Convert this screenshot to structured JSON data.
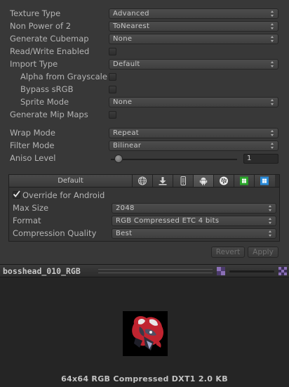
{
  "texture_settings": [
    {
      "label": "Texture Type",
      "value": "Advanced"
    },
    {
      "label": "Non Power of 2",
      "value": "ToNearest"
    },
    {
      "label": "Generate Cubemap",
      "value": "None"
    },
    {
      "label": "Read/Write Enabled"
    },
    {
      "label": "Import Type",
      "value": "Default"
    },
    {
      "label": "Alpha from Grayscale"
    },
    {
      "label": "Bypass sRGB"
    },
    {
      "label": "Sprite Mode",
      "value": "None"
    },
    {
      "label": "Generate Mip Maps"
    },
    {
      "label": "Wrap Mode",
      "value": "Repeat"
    },
    {
      "label": "Filter Mode",
      "value": "Bilinear"
    },
    {
      "label": "Aniso Level",
      "value": "1"
    }
  ],
  "platforms": {
    "default_label": "Default",
    "tabs": [
      "web-globe-icon",
      "standalone-download-icon",
      "iphone-icon",
      "android-icon",
      "blackberry-icon",
      "windows-store-icon",
      "windows-phone-icon"
    ],
    "active_tab": "android-icon"
  },
  "android": {
    "override_label": "Override for Android",
    "max_size_label": "Max Size",
    "max_size": "2048",
    "format_label": "Format",
    "format": "RGB Compressed ETC 4 bits",
    "quality_label": "Compression Quality",
    "quality": "Best"
  },
  "actions": {
    "revert": "Revert",
    "apply": "Apply"
  },
  "preview": {
    "title": "bosshead_010_RGB",
    "info": "64x64  RGB Compressed DXT1   2.0 KB"
  },
  "colors": {
    "panel": "#383838",
    "preview_bg": "#252525",
    "accent_green": "#2aa52a",
    "accent_blue": "#2a8ad8"
  }
}
